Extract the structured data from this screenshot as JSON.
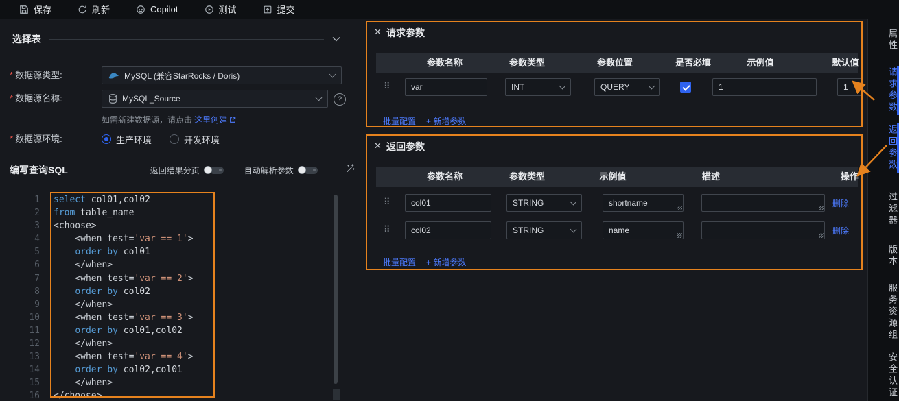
{
  "toolbar": {
    "items": [
      {
        "label": "保存"
      },
      {
        "label": "刷新"
      },
      {
        "label": "Copilot"
      },
      {
        "label": "测试"
      },
      {
        "label": "提交"
      }
    ]
  },
  "select_table": {
    "title": "选择表"
  },
  "form": {
    "help_mark": "?",
    "datasource_type": {
      "required_mark": "*",
      "label": "数据源类型:",
      "value": "MySQL (兼容StarRocks / Doris)"
    },
    "datasource_name": {
      "required_mark": "*",
      "label": "数据源名称:",
      "value": "MySQL_Source"
    },
    "helper": {
      "text": "如需新建数据源，请点击",
      "link": "这里创建"
    },
    "datasource_env": {
      "required_mark": "*",
      "label": "数据源环境:",
      "options": [
        {
          "label": "生产环境",
          "selected": true
        },
        {
          "label": "开发环境",
          "selected": false
        }
      ]
    }
  },
  "sql_section": {
    "title": "编写查询SQL",
    "toggle_pagination": "返回结果分页",
    "toggle_autoparse": "自动解析参数",
    "pagination_on": false,
    "autoparse_on": false
  },
  "editor": {
    "lines": [
      {
        "no": 1,
        "tokens": [
          [
            "kw",
            "select "
          ],
          [
            "id",
            "col01,col02"
          ]
        ]
      },
      {
        "no": 2,
        "tokens": [
          [
            "kw",
            "from "
          ],
          [
            "id",
            "table_name"
          ]
        ]
      },
      {
        "no": 3,
        "tokens": [
          [
            "tag",
            "<choose>"
          ]
        ]
      },
      {
        "no": 4,
        "tokens": [
          [
            "id",
            "    "
          ],
          [
            "tag",
            "<when test="
          ],
          [
            "str",
            "'var == 1'"
          ],
          [
            "tag",
            ">"
          ]
        ]
      },
      {
        "no": 5,
        "tokens": [
          [
            "id",
            "    "
          ],
          [
            "kw",
            "order by "
          ],
          [
            "id",
            "col01"
          ]
        ]
      },
      {
        "no": 6,
        "tokens": [
          [
            "id",
            "    "
          ],
          [
            "tag",
            "</when>"
          ]
        ]
      },
      {
        "no": 7,
        "tokens": [
          [
            "id",
            "    "
          ],
          [
            "tag",
            "<when test="
          ],
          [
            "str",
            "'var == 2'"
          ],
          [
            "tag",
            ">"
          ]
        ]
      },
      {
        "no": 8,
        "tokens": [
          [
            "id",
            "    "
          ],
          [
            "kw",
            "order by "
          ],
          [
            "id",
            "col02"
          ]
        ]
      },
      {
        "no": 9,
        "tokens": [
          [
            "id",
            "    "
          ],
          [
            "tag",
            "</when>"
          ]
        ]
      },
      {
        "no": 10,
        "tokens": [
          [
            "id",
            "    "
          ],
          [
            "tag",
            "<when test="
          ],
          [
            "str",
            "'var == 3'"
          ],
          [
            "tag",
            ">"
          ]
        ]
      },
      {
        "no": 11,
        "tokens": [
          [
            "id",
            "    "
          ],
          [
            "kw",
            "order by "
          ],
          [
            "id",
            "col01,col02"
          ]
        ]
      },
      {
        "no": 12,
        "tokens": [
          [
            "id",
            "    "
          ],
          [
            "tag",
            "</when>"
          ]
        ]
      },
      {
        "no": 13,
        "tokens": [
          [
            "id",
            "    "
          ],
          [
            "tag",
            "<when test="
          ],
          [
            "str",
            "'var == 4'"
          ],
          [
            "tag",
            ">"
          ]
        ]
      },
      {
        "no": 14,
        "tokens": [
          [
            "id",
            "    "
          ],
          [
            "kw",
            "order by "
          ],
          [
            "id",
            "col02,col01"
          ]
        ]
      },
      {
        "no": 15,
        "tokens": [
          [
            "id",
            "    "
          ],
          [
            "tag",
            "</when>"
          ]
        ]
      },
      {
        "no": 16,
        "tokens": [
          [
            "tag",
            "</choose>"
          ]
        ]
      }
    ]
  },
  "request_panel": {
    "title": "请求参数",
    "columns": [
      "参数名称",
      "参数类型",
      "参数位置",
      "是否必填",
      "示例值",
      "默认值"
    ],
    "rows": [
      {
        "name": "var",
        "type": "INT",
        "position": "QUERY",
        "required": true,
        "example": "1",
        "default": "1"
      }
    ],
    "batch_link": "批量配置",
    "add_link": "+ 新增参数"
  },
  "return_panel": {
    "title": "返回参数",
    "columns": [
      "参数名称",
      "参数类型",
      "示例值",
      "描述",
      "操作"
    ],
    "rows": [
      {
        "name": "col01",
        "type": "STRING",
        "example": "shortname",
        "desc": "",
        "action": "删除"
      },
      {
        "name": "col02",
        "type": "STRING",
        "example": "name",
        "desc": "",
        "action": "删除"
      }
    ],
    "batch_link": "批量配置",
    "add_link": "+ 新增参数"
  },
  "right_tabs": [
    {
      "label": "属性",
      "active": false
    },
    {
      "label": "请求参数",
      "active": true
    },
    {
      "label": "返回参数",
      "active": true
    },
    {
      "label": "过滤器",
      "active": false
    },
    {
      "label": "版本",
      "active": false
    },
    {
      "label": "服务资源组",
      "active": false
    },
    {
      "label": "安全认证",
      "active": false
    }
  ],
  "icons": {
    "close": "✕",
    "drag": "⠿"
  },
  "colors": {
    "accent": "#2f63f0",
    "link": "#4d7bff",
    "annotation": "#e5821e"
  }
}
